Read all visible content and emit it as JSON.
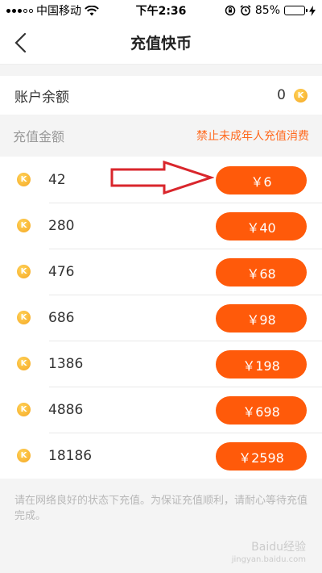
{
  "status": {
    "carrier": "中国移动",
    "time": "下午2:36",
    "battery": "85%",
    "battery_level": 0.85
  },
  "header": {
    "title": "充值快币"
  },
  "balance": {
    "label": "账户余额",
    "value": "0"
  },
  "section": {
    "label": "充值金额",
    "warning": "禁止未成年人充值消费"
  },
  "packages": [
    {
      "coins": "42",
      "price": "￥6"
    },
    {
      "coins": "280",
      "price": "￥40"
    },
    {
      "coins": "476",
      "price": "￥68"
    },
    {
      "coins": "686",
      "price": "￥98"
    },
    {
      "coins": "1386",
      "price": "￥198"
    },
    {
      "coins": "4886",
      "price": "￥698"
    },
    {
      "coins": "18186",
      "price": "￥2598"
    }
  ],
  "note": "请在网络良好的状态下充值。为保证充值顺利，请耐心等待充值完成。",
  "coin_letter": "K",
  "watermark": {
    "main": "Baidu经验",
    "sub": "jingyan.baidu.com"
  },
  "colors": {
    "accent": "#ff5a0a",
    "warning": "#ff6a1f",
    "coin": "#f5a623",
    "arrow": "#d9262c"
  }
}
